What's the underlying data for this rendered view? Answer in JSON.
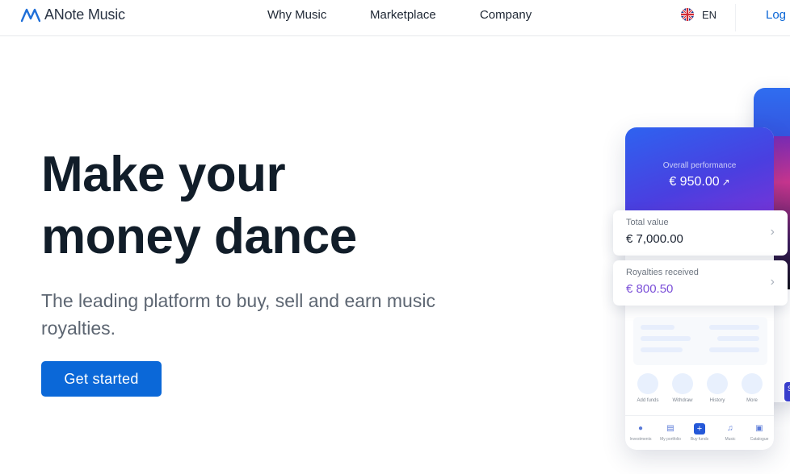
{
  "nav": {
    "brand": "ANote Music",
    "links": [
      "Why Music",
      "Marketplace",
      "Company"
    ],
    "language": "EN",
    "login": "Log in"
  },
  "hero": {
    "title_line1": "Make your",
    "title_line2": "money dance",
    "subtitle": "The leading platform to buy, sell and earn music royalties.",
    "cta": "Get started"
  },
  "mockup": {
    "performance_label": "Overall performance",
    "performance_value": "€ 950.00",
    "cards": [
      {
        "label": "Total value",
        "value": "€ 7,000.00"
      },
      {
        "label": "Royalties received",
        "value": "€ 800.50"
      }
    ],
    "actions": [
      "Add funds",
      "Withdraw",
      "History",
      "More"
    ],
    "tabs": [
      "Investments",
      "My portfolio",
      "Buy funds",
      "Music",
      "Catalogue"
    ],
    "side_button": "S"
  },
  "colors": {
    "primary": "#0b68d8",
    "heading": "#111d29",
    "gradient_start": "#2e63f0",
    "gradient_end": "#7c32d6",
    "royalty_accent": "#7b4fd8"
  },
  "icons": {
    "logo": "anote-logo-icon",
    "flag": "uk-flag-icon",
    "trend": "trending-up-icon",
    "chevron": "chevron-right-icon"
  }
}
